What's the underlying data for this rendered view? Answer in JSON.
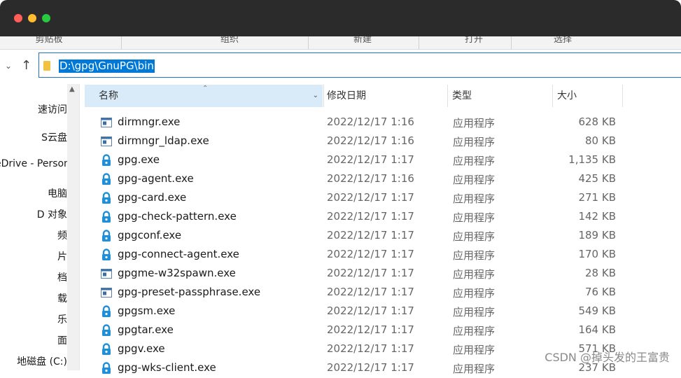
{
  "ribbon": {
    "groups": [
      "剪贴板",
      "组织",
      "新建",
      "打开",
      "选择"
    ]
  },
  "address": {
    "path": "D:\\gpg\\GnuPG\\bin"
  },
  "sidebar": {
    "items": [
      "速访问",
      "S云盘",
      "eDrive - Personal",
      "电脑",
      "D 对象",
      "频",
      "片",
      "档",
      "载",
      "乐",
      "面",
      "地磁盘 (C:)"
    ]
  },
  "columns": {
    "name": "名称",
    "date": "修改日期",
    "type": "类型",
    "size": "大小"
  },
  "files": [
    {
      "name": "dirmngr.exe",
      "date": "2022/12/17 1:16",
      "type": "应用程序",
      "size": "628 KB",
      "icon": "app-window-icon"
    },
    {
      "name": "dirmngr_ldap.exe",
      "date": "2022/12/17 1:16",
      "type": "应用程序",
      "size": "80 KB",
      "icon": "app-window-icon"
    },
    {
      "name": "gpg.exe",
      "date": "2022/12/17 1:17",
      "type": "应用程序",
      "size": "1,135 KB",
      "icon": "gpg-lock-icon"
    },
    {
      "name": "gpg-agent.exe",
      "date": "2022/12/17 1:16",
      "type": "应用程序",
      "size": "425 KB",
      "icon": "gpg-lock-icon"
    },
    {
      "name": "gpg-card.exe",
      "date": "2022/12/17 1:17",
      "type": "应用程序",
      "size": "271 KB",
      "icon": "gpg-lock-icon"
    },
    {
      "name": "gpg-check-pattern.exe",
      "date": "2022/12/17 1:17",
      "type": "应用程序",
      "size": "142 KB",
      "icon": "gpg-lock-icon"
    },
    {
      "name": "gpgconf.exe",
      "date": "2022/12/17 1:17",
      "type": "应用程序",
      "size": "189 KB",
      "icon": "gpg-lock-icon"
    },
    {
      "name": "gpg-connect-agent.exe",
      "date": "2022/12/17 1:17",
      "type": "应用程序",
      "size": "170 KB",
      "icon": "gpg-lock-icon"
    },
    {
      "name": "gpgme-w32spawn.exe",
      "date": "2022/12/17 1:17",
      "type": "应用程序",
      "size": "28 KB",
      "icon": "app-window-icon"
    },
    {
      "name": "gpg-preset-passphrase.exe",
      "date": "2022/12/17 1:17",
      "type": "应用程序",
      "size": "76 KB",
      "icon": "app-window-icon"
    },
    {
      "name": "gpgsm.exe",
      "date": "2022/12/17 1:17",
      "type": "应用程序",
      "size": "549 KB",
      "icon": "gpg-lock-icon"
    },
    {
      "name": "gpgtar.exe",
      "date": "2022/12/17 1:17",
      "type": "应用程序",
      "size": "164 KB",
      "icon": "gpg-lock-icon"
    },
    {
      "name": "gpgv.exe",
      "date": "2022/12/17 1:17",
      "type": "应用程序",
      "size": "571 KB",
      "icon": "gpg-lock-icon"
    },
    {
      "name": "gpg-wks-client.exe",
      "date": "2022/12/17 1:17",
      "type": "应用程序",
      "size": "237 KB",
      "icon": "gpg-lock-icon"
    }
  ],
  "watermark": "CSDN @掉头发的王富贵",
  "colors": {
    "accent": "#0078d7",
    "header_highlight": "#d9ebf9",
    "titlebar": "#2b2b2b"
  }
}
